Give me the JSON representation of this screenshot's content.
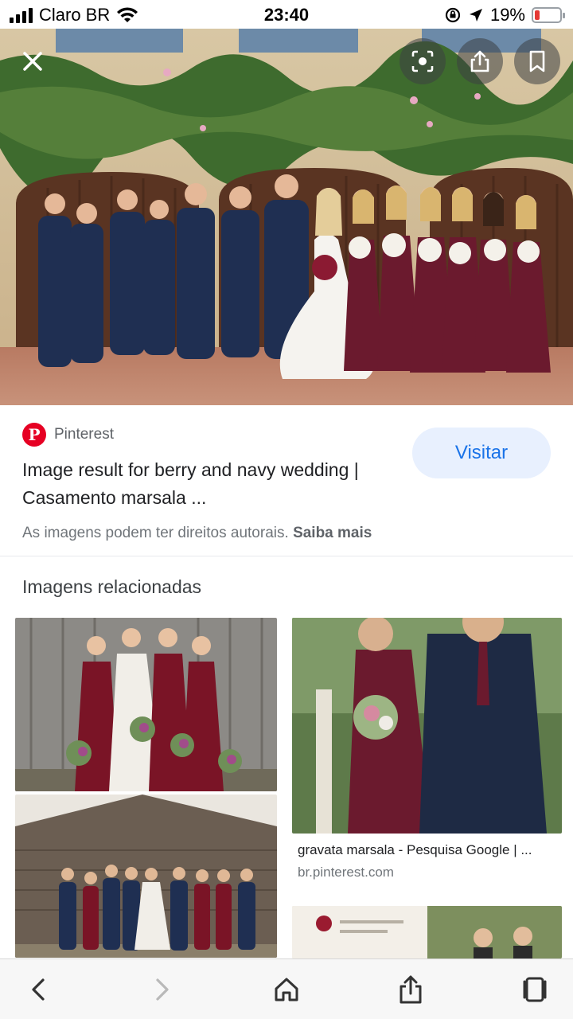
{
  "status_bar": {
    "carrier": "Claro BR",
    "time": "23:40",
    "battery_percent": "19%",
    "battery_level": 0.19,
    "icons": [
      "signal-icon",
      "wifi-icon",
      "rotation-lock-icon",
      "location-arrow-icon",
      "battery-icon"
    ]
  },
  "hero": {
    "icons": [
      "close-icon",
      "lens-icon",
      "share-icon",
      "bookmark-icon"
    ]
  },
  "result": {
    "source": "Pinterest",
    "title": "Image result for berry and navy wedding | Casamento marsala ...",
    "visit_label": "Visitar",
    "copyright_text": "As imagens podem ter direitos autorais.",
    "learn_more": "Saiba mais"
  },
  "related": {
    "heading": "Imagens relacionadas",
    "items": [
      {
        "caption": "gravata marsala - Pesquisa Google | ...",
        "domain": "br.pinterest.com"
      }
    ]
  },
  "toolbar": {
    "icons": [
      "back-icon",
      "forward-icon",
      "home-icon",
      "share-icon",
      "tabs-icon"
    ]
  },
  "colors": {
    "accent": "#1a73e8",
    "visit_bg": "#e8f0fe",
    "pinterest": "#e60023",
    "navy": "#1f2f52",
    "berry": "#6b1a2e"
  }
}
